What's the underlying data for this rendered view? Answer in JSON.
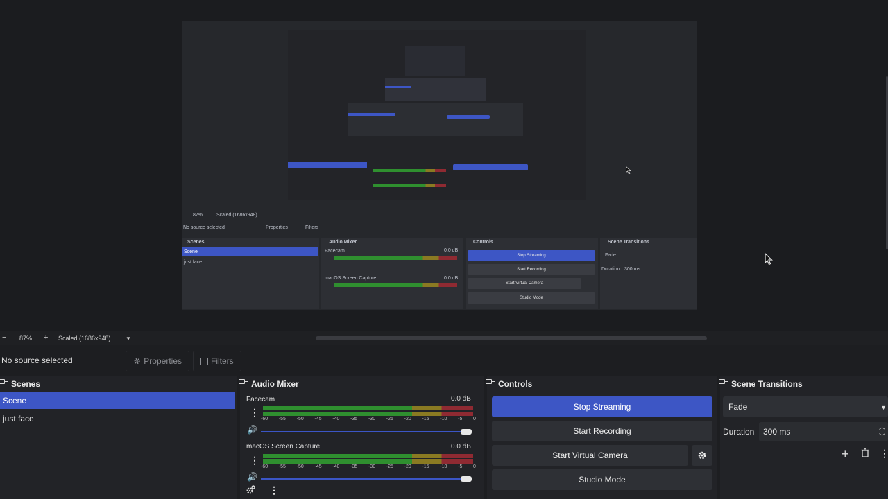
{
  "preview": {
    "canvas": {
      "nested_zoom": "87%",
      "nested_scale": "Scaled (1686x948)",
      "nested_no_source": "No source selected",
      "nested_properties": "Properties",
      "nested_filters": "Filters",
      "scenes_title": "Scenes",
      "scene_items": [
        "Scene",
        "just face"
      ],
      "audio_title": "Audio Mixer",
      "audio_facecam": "Facecam",
      "audio_mac": "macOS Screen Capture",
      "audio_db": "0.0 dB",
      "controls_title": "Controls",
      "controls": [
        "Stop Streaming",
        "Start Recording",
        "Start Virtual Camera",
        "Studio Mode"
      ],
      "transitions_title": "Scene Transitions",
      "transition_value": "Fade",
      "duration_label": "Duration",
      "duration_value": "300 ms"
    }
  },
  "zoombar": {
    "minus": "−",
    "zoom": "87%",
    "plus": "+",
    "scale": "Scaled (1686x948)",
    "caret": "▼"
  },
  "sourcebar": {
    "no_source": "No source selected",
    "properties": "Properties",
    "filters": "Filters"
  },
  "scenes": {
    "title": "Scenes",
    "items": [
      {
        "label": "Scene",
        "selected": true
      },
      {
        "label": "just face",
        "selected": false
      }
    ]
  },
  "audio_mixer": {
    "title": "Audio Mixer",
    "channels": [
      {
        "name": "Facecam",
        "db": "0.0 dB",
        "volume_percent": 100
      },
      {
        "name": "macOS Screen Capture",
        "db": "0.0 dB",
        "volume_percent": 100
      }
    ],
    "ticks": [
      "-60",
      "-55",
      "-50",
      "-45",
      "-40",
      "-35",
      "-30",
      "-25",
      "-20",
      "-15",
      "-10",
      "-5",
      "0"
    ]
  },
  "controls": {
    "title": "Controls",
    "stop_streaming": "Stop Streaming",
    "start_recording": "Start Recording",
    "start_virtual_camera": "Start Virtual Camera",
    "studio_mode": "Studio Mode"
  },
  "scene_transitions": {
    "title": "Scene Transitions",
    "transition": "Fade",
    "duration_label": "Duration",
    "duration_value": "300 ms"
  },
  "colors": {
    "accent": "#3d56c5",
    "background": "#1d1e21",
    "panel": "#222327",
    "meter_green": "#2f8f2f",
    "meter_yellow": "#8a7a22",
    "meter_red": "#8f2a32"
  }
}
